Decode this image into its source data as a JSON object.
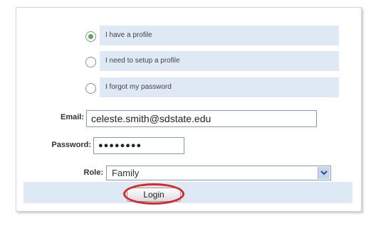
{
  "login_options": [
    {
      "label": "I have a profile",
      "selected": true
    },
    {
      "label": "I need to setup a profile",
      "selected": false
    },
    {
      "label": "I forgot my password",
      "selected": false
    }
  ],
  "form": {
    "email_label": "Email:",
    "email_value": "celeste.smith@sdstate.edu",
    "password_label": "Password:",
    "password_value": "●●●●●●●●",
    "role_label": "Role:",
    "role_value": "Family"
  },
  "login_button": "Login",
  "colors": {
    "row_background": "#dfe8f5",
    "selected_radio": "#5aa85a",
    "highlight_ring": "#d9262c",
    "input_border": "#7f9db9"
  }
}
